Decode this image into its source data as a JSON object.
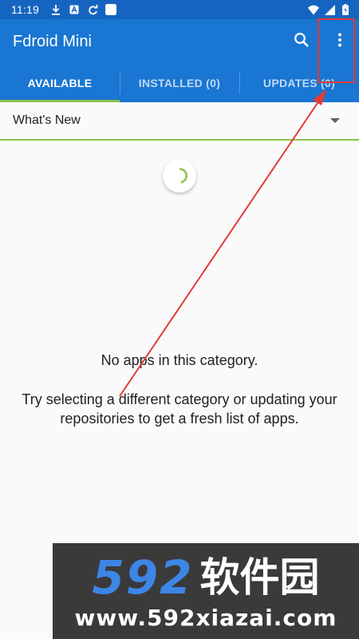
{
  "status_bar": {
    "time": "11:19",
    "left_icons": [
      "download-icon",
      "app-badge-icon",
      "sync-icon",
      "square-notification-icon"
    ],
    "right_icons": [
      "wifi-icon",
      "signal-icon",
      "battery-icon"
    ]
  },
  "app_bar": {
    "title": "Fdroid Mini",
    "actions": [
      "search-icon",
      "more-vertical-icon"
    ]
  },
  "tabs": [
    {
      "label": "AVAILABLE",
      "active": true
    },
    {
      "label": "INSTALLED (0)",
      "active": false
    },
    {
      "label": "UPDATES (0)",
      "active": false
    }
  ],
  "category": {
    "selected": "What's New"
  },
  "empty_state": {
    "title": "No apps in this category.",
    "message": "Try selecting a different category or updating your repositories to get a fresh list of apps."
  },
  "watermark": {
    "brand_number": "592",
    "brand_text": "软件园",
    "url": "www.592xiazai.com"
  },
  "colors": {
    "status_bar": "#1565c0",
    "primary": "#1976d2",
    "accent": "#8bc34a",
    "annotation": "#e53935",
    "watermark_bg": "#3a3a3a",
    "watermark_blue": "#3d86e6"
  }
}
